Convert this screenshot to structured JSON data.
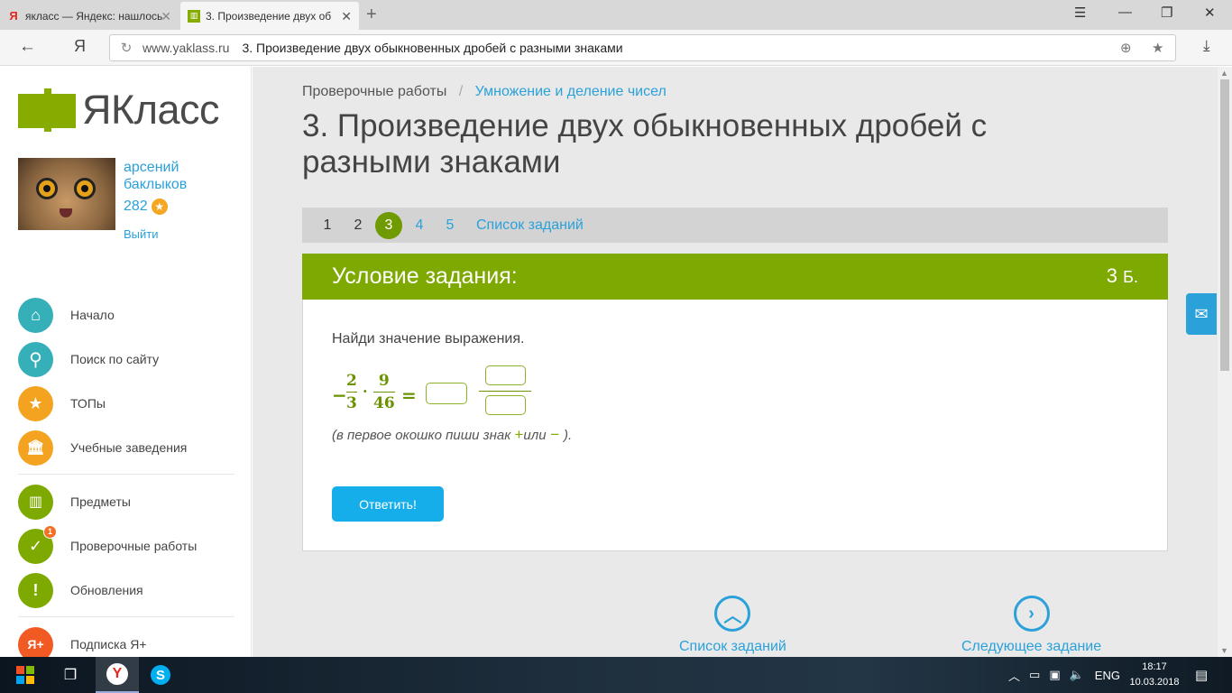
{
  "browser": {
    "tabs": [
      {
        "label": "яклacc — Яндекс: нашлось",
        "active": false
      },
      {
        "label": "3. Произведение двух об",
        "active": true
      }
    ],
    "new_tab": "+",
    "window": {
      "minimize": "☰",
      "min": "—",
      "restore": "❐",
      "close": "✕"
    },
    "ya_button": "Я",
    "url_domain": "www.yaklass.ru",
    "url_title": "3. Произведение двух обыкновенных дробей с разными знаками"
  },
  "sidebar": {
    "logo_text": "ЯКласс",
    "user": {
      "name": "арсений баклыков",
      "points": "282",
      "logout": "Выйти"
    },
    "nav": [
      {
        "label": "Начало",
        "icon": "home-icon",
        "glyph": "⌂"
      },
      {
        "label": "Поиск по сайту",
        "icon": "search-icon",
        "glyph": "⚲"
      },
      {
        "label": "ТОПы",
        "icon": "star-icon",
        "glyph": "★"
      },
      {
        "label": "Учебные заведения",
        "icon": "institution-icon",
        "glyph": "⌂"
      },
      {
        "label": "Предметы",
        "icon": "book-icon",
        "glyph": "▥"
      },
      {
        "label": "Проверочные работы",
        "icon": "check-icon",
        "glyph": "✓",
        "badge": "1"
      },
      {
        "label": "Обновления",
        "icon": "exclamation-icon",
        "glyph": "!"
      },
      {
        "label": "Подписка Я+",
        "icon": "ya-plus-icon",
        "glyph": "Я+"
      }
    ]
  },
  "main": {
    "breadcrumb": {
      "root": "Проверочные работы",
      "separator": "/",
      "current": "Умножение и деление чисел"
    },
    "title": "3. Произведение двух обыкновенных дробей с разными знаками",
    "task_nav": {
      "numbers": [
        "1",
        "2",
        "3",
        "4",
        "5"
      ],
      "current": "3",
      "list_link": "Список заданий"
    },
    "task": {
      "header": "Условие задания:",
      "points": "3",
      "points_unit": "Б.",
      "condition": "Найди значение выражения.",
      "expression": {
        "minus": "−",
        "frac1_num": "2",
        "frac1_den": "3",
        "dot": "·",
        "frac2_num": "9",
        "frac2_den": "46",
        "equals": "="
      },
      "hint_before": "(в первое окошко пиши знак ",
      "hint_plus": "+",
      "hint_or": "или",
      "hint_minus": " − ",
      "hint_after": ").",
      "answer_button": "Ответить!"
    },
    "bottom": {
      "list_link": "Список заданий",
      "next_link": "Следующее задание"
    }
  },
  "taskbar": {
    "lang": "ENG",
    "time": "18:17",
    "date": "10.03.2018"
  },
  "colors": {
    "brand_green": "#7ea900",
    "link_blue": "#2aa1d9",
    "button_blue": "#15aeea"
  }
}
